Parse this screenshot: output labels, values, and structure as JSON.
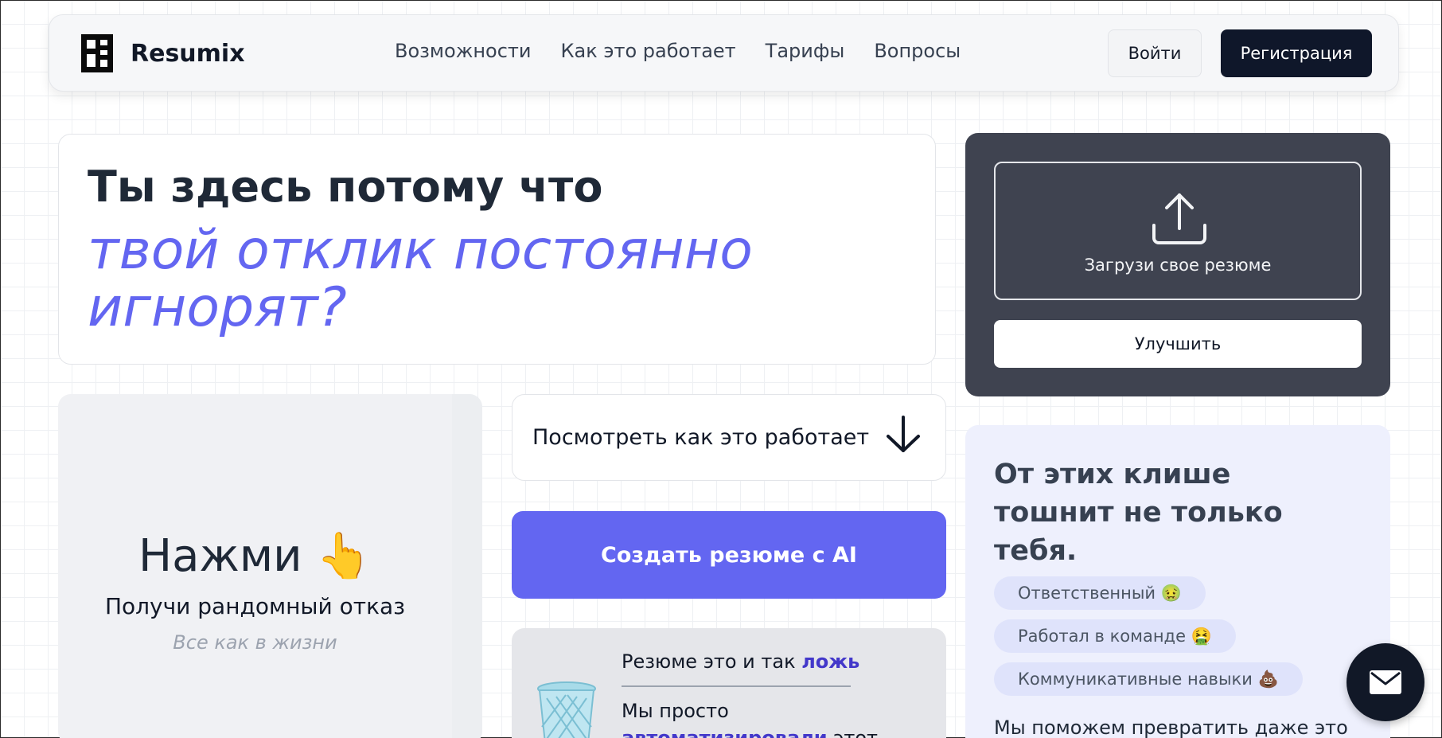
{
  "nav": {
    "logo_text": "Resumix",
    "links": [
      "Возможности",
      "Как это работает",
      "Тарифы",
      "Вопросы"
    ],
    "login_label": "Войти",
    "register_label": "Регистрация"
  },
  "hero": {
    "line1": "Ты здесь потому что",
    "line2": "твой отклик постоянно игнорят?"
  },
  "upload": {
    "dropzone_label": "Загрузи свое резюме",
    "improve_label": "Улучшить",
    "icon": "upload-icon"
  },
  "click_card": {
    "title": "Нажми 👆",
    "subtitle": "Получи рандомный отказ",
    "note": "Все как в жизни"
  },
  "how": {
    "label": "Посмотреть как это работает",
    "icon": "arrow-down-icon"
  },
  "ai_button": {
    "label": "Создать резюме с AI"
  },
  "lie_card": {
    "line1_prefix": "Резюме это и так ",
    "line1_highlight": "ложь",
    "line2": "Мы просто",
    "line3_highlight": "автоматизировали",
    "line3_suffix": " этот",
    "icon": "trash-icon"
  },
  "cliche_card": {
    "title": "От этих клише тошнит не только тебя.",
    "chips": [
      "Ответственный 🤢",
      "Работал в команде 🤮",
      "Коммуникативные навыки 💩"
    ],
    "footer": "Мы поможем превратить даже это"
  },
  "fab": {
    "icon": "mail-icon"
  },
  "colors": {
    "accent": "#6366f1",
    "dark": "#0f172a",
    "upload_card": "#3f4350",
    "cliche_bg": "#eef0fd"
  }
}
